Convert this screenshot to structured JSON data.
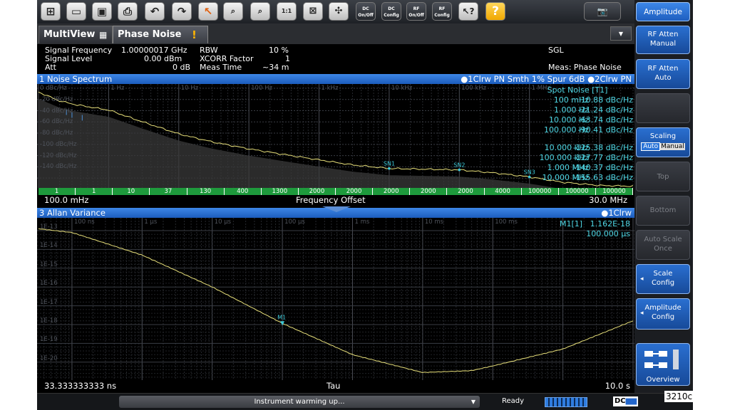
{
  "toolbar": {
    "buttons": [
      {
        "icon": "windows-icon"
      },
      {
        "icon": "open-folder-icon"
      },
      {
        "icon": "save-icon"
      },
      {
        "icon": "print-icon"
      },
      {
        "icon": "undo-icon"
      },
      {
        "icon": "redo-icon"
      },
      {
        "icon": "pointer-icon"
      },
      {
        "icon": "marker-zoom-icon"
      },
      {
        "icon": "multi-zoom-icon"
      },
      {
        "icon": "zoom-1to1-icon"
      },
      {
        "icon": "screen-icon"
      },
      {
        "icon": "measure-wizard-icon"
      }
    ],
    "dc_onoff": {
      "line1": "DC",
      "line2": "On/Off"
    },
    "dc_config": {
      "line1": "DC",
      "line2": "Config"
    },
    "rf_onoff": {
      "line1": "RF",
      "line2": "On/Off"
    },
    "rf_config": {
      "line1": "RF",
      "line2": "Config"
    },
    "help_label": "?"
  },
  "softkeys": {
    "title": "Amplitude",
    "rf_atten_manual": {
      "line1": "RF Atten",
      "line2": "Manual"
    },
    "rf_atten_auto": {
      "line1": "RF Atten",
      "line2": "Auto"
    },
    "scaling": {
      "label": "Scaling",
      "opt1": "Auto",
      "opt2": "Manual"
    },
    "top": "Top",
    "bottom": "Bottom",
    "auto_scale_once": {
      "line1": "Auto Scale",
      "line2": "Once"
    },
    "scale_config": {
      "line1": "Scale",
      "line2": "Config"
    },
    "amplitude_config": {
      "line1": "Amplitude",
      "line2": "Config"
    },
    "overview": "Overview"
  },
  "tabs": {
    "multiview": "MultiView",
    "phase_noise": "Phase Noise",
    "warning": "!"
  },
  "info": {
    "signal_frequency_label": "Signal Frequency",
    "signal_frequency_value": "1.00000017 GHz",
    "signal_level_label": "Signal Level",
    "signal_level_value": "0.00 dBm",
    "att_label": "Att",
    "att_value": "0 dB",
    "rbw_label": "RBW",
    "rbw_value": "10 %",
    "xcorr_label": "XCORR Factor",
    "xcorr_value": "1",
    "meas_time_label": "Meas Time",
    "meas_time_value": "~34 m",
    "sgl": "SGL",
    "meas": "Meas: Phase Noise"
  },
  "noise_spectrum": {
    "title": "1 Noise Spectrum",
    "legend": "●1Clrw PN Smth 1% Spur 6dB ●2Clrw PN",
    "y_ticks": [
      "0 dBc/Hz",
      "-20 dBc/Hz",
      "-40 dBc/Hz",
      "-60 dBc/Hz",
      "-80 dBc/Hz",
      "-100 dBc/Hz",
      "-120 dBc/Hz",
      "-140 dBc/Hz"
    ],
    "x_decades": [
      "1 Hz",
      "10 Hz",
      "100 Hz",
      "1 kHz",
      "10 kHz",
      "100 kHz",
      "1 MHz"
    ],
    "spot_noise": {
      "title": "Spot Noise [T1]",
      "rows": [
        {
          "offset": "100 mHz",
          "value": "10.88 dBc/Hz"
        },
        {
          "offset": "1.000 Hz",
          "value": "-21.24 dBc/Hz"
        },
        {
          "offset": "10.000 Hz",
          "value": "-63.74 dBc/Hz"
        },
        {
          "offset": "100.000 Hz",
          "value": "-90.41 dBc/Hz"
        },
        {
          "offset": "10.000 kHz",
          "value": "-125.38 dBc/Hz"
        },
        {
          "offset": "100.000 kHz",
          "value": "-127.77 dBc/Hz"
        },
        {
          "offset": "1.000 MHz",
          "value": "-140.37 dBc/Hz"
        },
        {
          "offset": "10.000 MHz",
          "value": "-155.63 dBc/Hz"
        }
      ]
    },
    "markers": [
      "SN1",
      "SN2",
      "SN3"
    ],
    "half_decades": [
      "1",
      "1",
      "10",
      "37",
      "130",
      "400",
      "1300",
      "2000",
      "2000",
      "2000",
      "2000",
      "2000",
      "4000",
      "100000",
      "100000",
      "100000"
    ],
    "x_start": "100.0 mHz",
    "x_label": "Frequency Offset",
    "x_stop": "30.0 MHz"
  },
  "allan": {
    "title": "3 Allan Variance",
    "legend": "●1Clrw",
    "y_ticks": [
      "1E-13",
      "1E-14",
      "1E-15",
      "1E-16",
      "1E-17",
      "1E-18",
      "1E-19",
      "1E-20"
    ],
    "x_decades": [
      "100 ns",
      "1 µs",
      "10 µs",
      "100 µs",
      "1 ms",
      "10 ms",
      "100 ms"
    ],
    "marker_label": "M1",
    "marker_readout": "M1[1]",
    "marker_value": "1.162E-18",
    "marker_x": "100.000 µs",
    "x_start": "33.333333333 ns",
    "x_label": "Tau",
    "x_stop": "10.0 s"
  },
  "status": {
    "message": "Instrument warming up...",
    "ready": "Ready",
    "dc": "DC",
    "corner": "3210c"
  },
  "colors": {
    "trace": "#e8e07a",
    "marker": "#3cc9d8",
    "title_blue": "#2a74d8",
    "grid": "#3a3d44",
    "half_decade_green": "#22aa44"
  }
}
